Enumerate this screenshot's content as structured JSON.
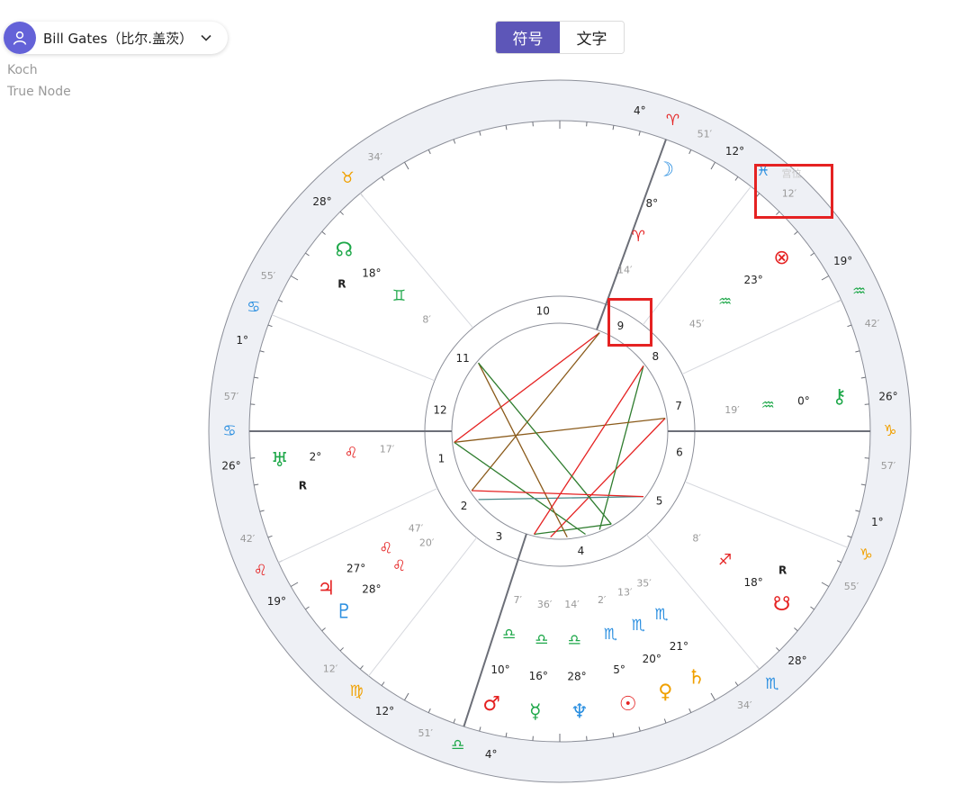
{
  "profile": {
    "name": "Bill Gates（比尔.盖茨）"
  },
  "info": {
    "house_system": "Koch",
    "node_type": "True Node"
  },
  "toggle": {
    "symbols_label": "符号",
    "text_label": "文字",
    "selected": "symbols"
  },
  "colors": {
    "accent": "#5d56b8",
    "fire": "#e52222",
    "earth": "#f0a000",
    "air": "#1fa84a",
    "water": "#2b8fe0",
    "highlight": "#e52222"
  },
  "chart": {
    "cusps": [
      {
        "deg": "26°",
        "sign": "cancer-glyph",
        "min": "57′"
      },
      {
        "deg": "19°",
        "sign": "leo-glyph",
        "min": "42′"
      },
      {
        "deg": "12°",
        "sign": "virgo-glyph",
        "min": "12′"
      },
      {
        "deg": "4°",
        "sign": "libra-glyph",
        "min": "51′"
      },
      {
        "deg": "28°",
        "sign": "scorpio-glyph",
        "min": "34′"
      },
      {
        "deg": "1°",
        "sign": "capricorn-glyph",
        "min": "55′"
      },
      {
        "deg": "26°",
        "sign": "capricorn-glyph",
        "min": "57′"
      },
      {
        "deg": "19°",
        "sign": "aquarius-glyph",
        "min": "42′"
      },
      {
        "deg": "12°",
        "sign": "pisces-glyph",
        "min": "12′"
      },
      {
        "deg": "4°",
        "sign": "aries-glyph",
        "min": "51′"
      },
      {
        "deg": "28°",
        "sign": "taurus-glyph",
        "min": "34′"
      },
      {
        "deg": "1°",
        "sign": "cancer-glyph",
        "min": "55′"
      }
    ],
    "planets": [
      {
        "name": "uranus-glyph",
        "deg": "2°",
        "sign": "leo-glyph",
        "min": "17′",
        "retro": "R"
      },
      {
        "name": "jupiter-glyph",
        "deg": "27°",
        "sign": "leo-glyph",
        "min": "47′"
      },
      {
        "name": "pluto-glyph",
        "deg": "28°",
        "sign": "leo-glyph",
        "min": "20′"
      },
      {
        "name": "mars-glyph",
        "deg": "10°",
        "sign": "libra-glyph",
        "min": "7′"
      },
      {
        "name": "mercury-glyph",
        "deg": "16°",
        "sign": "libra-glyph",
        "min": "36′"
      },
      {
        "name": "neptune-glyph",
        "deg": "28°",
        "sign": "libra-glyph",
        "min": "14′"
      },
      {
        "name": "sun-glyph",
        "deg": "5°",
        "sign": "scorpio-glyph",
        "min": "2′"
      },
      {
        "name": "venus-glyph",
        "deg": "20°",
        "sign": "scorpio-glyph",
        "min": "13′"
      },
      {
        "name": "saturn-glyph",
        "deg": "21°",
        "sign": "scorpio-glyph",
        "min": "35′"
      },
      {
        "name": "south-node-glyph",
        "deg": "18°",
        "sign": "sagittarius-glyph",
        "min": "8′",
        "retro": "R"
      },
      {
        "name": "chiron-glyph",
        "deg": "0°",
        "sign": "aquarius-glyph",
        "min": "19′"
      },
      {
        "name": "fortune-glyph",
        "deg": "23°",
        "sign": "aquarius-glyph",
        "min": "45′"
      },
      {
        "name": "moon-glyph",
        "deg": "8°",
        "sign": "aries-glyph",
        "min": "14′"
      },
      {
        "name": "north-node-glyph",
        "deg": "18°",
        "sign": "gemini-glyph",
        "min": "8′",
        "retro": "R"
      }
    ],
    "glyph_chars": {
      "aries-glyph": "♈",
      "taurus-glyph": "♉",
      "gemini-glyph": "♊",
      "cancer-glyph": "♋",
      "leo-glyph": "♌",
      "virgo-glyph": "♍",
      "libra-glyph": "♎",
      "scorpio-glyph": "♏",
      "sagittarius-glyph": "♐",
      "capricorn-glyph": "♑",
      "aquarius-glyph": "♒",
      "pisces-glyph": "♓",
      "sun-glyph": "☉",
      "moon-glyph": "☽",
      "mercury-glyph": "☿",
      "venus-glyph": "♀",
      "mars-glyph": "♂",
      "jupiter-glyph": "♃",
      "saturn-glyph": "♄",
      "uranus-glyph": "♅",
      "neptune-glyph": "♆",
      "pluto-glyph": "♇",
      "north-node-glyph": "☊",
      "south-node-glyph": "☋",
      "chiron-glyph": "⚷",
      "fortune-glyph": "⊗"
    },
    "house_numbers": [
      "1",
      "2",
      "3",
      "4",
      "5",
      "6",
      "7",
      "8",
      "9",
      "10",
      "11",
      "12"
    ],
    "faded_text": "宫位"
  }
}
